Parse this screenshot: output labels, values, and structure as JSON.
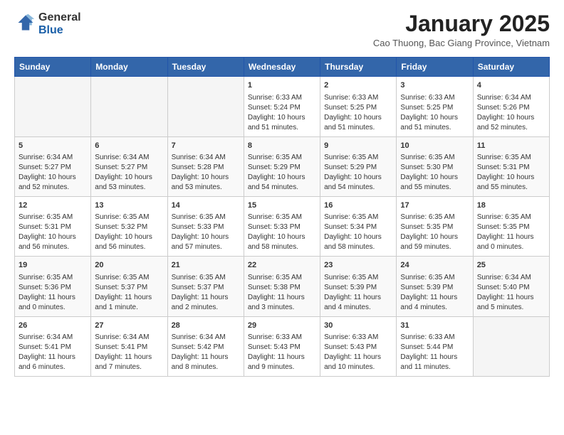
{
  "logo": {
    "general": "General",
    "blue": "Blue"
  },
  "header": {
    "month": "January 2025",
    "location": "Cao Thuong, Bac Giang Province, Vietnam"
  },
  "weekdays": [
    "Sunday",
    "Monday",
    "Tuesday",
    "Wednesday",
    "Thursday",
    "Friday",
    "Saturday"
  ],
  "weeks": [
    [
      {
        "day": "",
        "info": ""
      },
      {
        "day": "",
        "info": ""
      },
      {
        "day": "",
        "info": ""
      },
      {
        "day": "1",
        "info": "Sunrise: 6:33 AM\nSunset: 5:24 PM\nDaylight: 10 hours\nand 51 minutes."
      },
      {
        "day": "2",
        "info": "Sunrise: 6:33 AM\nSunset: 5:25 PM\nDaylight: 10 hours\nand 51 minutes."
      },
      {
        "day": "3",
        "info": "Sunrise: 6:33 AM\nSunset: 5:25 PM\nDaylight: 10 hours\nand 51 minutes."
      },
      {
        "day": "4",
        "info": "Sunrise: 6:34 AM\nSunset: 5:26 PM\nDaylight: 10 hours\nand 52 minutes."
      }
    ],
    [
      {
        "day": "5",
        "info": "Sunrise: 6:34 AM\nSunset: 5:27 PM\nDaylight: 10 hours\nand 52 minutes."
      },
      {
        "day": "6",
        "info": "Sunrise: 6:34 AM\nSunset: 5:27 PM\nDaylight: 10 hours\nand 53 minutes."
      },
      {
        "day": "7",
        "info": "Sunrise: 6:34 AM\nSunset: 5:28 PM\nDaylight: 10 hours\nand 53 minutes."
      },
      {
        "day": "8",
        "info": "Sunrise: 6:35 AM\nSunset: 5:29 PM\nDaylight: 10 hours\nand 54 minutes."
      },
      {
        "day": "9",
        "info": "Sunrise: 6:35 AM\nSunset: 5:29 PM\nDaylight: 10 hours\nand 54 minutes."
      },
      {
        "day": "10",
        "info": "Sunrise: 6:35 AM\nSunset: 5:30 PM\nDaylight: 10 hours\nand 55 minutes."
      },
      {
        "day": "11",
        "info": "Sunrise: 6:35 AM\nSunset: 5:31 PM\nDaylight: 10 hours\nand 55 minutes."
      }
    ],
    [
      {
        "day": "12",
        "info": "Sunrise: 6:35 AM\nSunset: 5:31 PM\nDaylight: 10 hours\nand 56 minutes."
      },
      {
        "day": "13",
        "info": "Sunrise: 6:35 AM\nSunset: 5:32 PM\nDaylight: 10 hours\nand 56 minutes."
      },
      {
        "day": "14",
        "info": "Sunrise: 6:35 AM\nSunset: 5:33 PM\nDaylight: 10 hours\nand 57 minutes."
      },
      {
        "day": "15",
        "info": "Sunrise: 6:35 AM\nSunset: 5:33 PM\nDaylight: 10 hours\nand 58 minutes."
      },
      {
        "day": "16",
        "info": "Sunrise: 6:35 AM\nSunset: 5:34 PM\nDaylight: 10 hours\nand 58 minutes."
      },
      {
        "day": "17",
        "info": "Sunrise: 6:35 AM\nSunset: 5:35 PM\nDaylight: 10 hours\nand 59 minutes."
      },
      {
        "day": "18",
        "info": "Sunrise: 6:35 AM\nSunset: 5:35 PM\nDaylight: 11 hours\nand 0 minutes."
      }
    ],
    [
      {
        "day": "19",
        "info": "Sunrise: 6:35 AM\nSunset: 5:36 PM\nDaylight: 11 hours\nand 0 minutes."
      },
      {
        "day": "20",
        "info": "Sunrise: 6:35 AM\nSunset: 5:37 PM\nDaylight: 11 hours\nand 1 minute."
      },
      {
        "day": "21",
        "info": "Sunrise: 6:35 AM\nSunset: 5:37 PM\nDaylight: 11 hours\nand 2 minutes."
      },
      {
        "day": "22",
        "info": "Sunrise: 6:35 AM\nSunset: 5:38 PM\nDaylight: 11 hours\nand 3 minutes."
      },
      {
        "day": "23",
        "info": "Sunrise: 6:35 AM\nSunset: 5:39 PM\nDaylight: 11 hours\nand 4 minutes."
      },
      {
        "day": "24",
        "info": "Sunrise: 6:35 AM\nSunset: 5:39 PM\nDaylight: 11 hours\nand 4 minutes."
      },
      {
        "day": "25",
        "info": "Sunrise: 6:34 AM\nSunset: 5:40 PM\nDaylight: 11 hours\nand 5 minutes."
      }
    ],
    [
      {
        "day": "26",
        "info": "Sunrise: 6:34 AM\nSunset: 5:41 PM\nDaylight: 11 hours\nand 6 minutes."
      },
      {
        "day": "27",
        "info": "Sunrise: 6:34 AM\nSunset: 5:41 PM\nDaylight: 11 hours\nand 7 minutes."
      },
      {
        "day": "28",
        "info": "Sunrise: 6:34 AM\nSunset: 5:42 PM\nDaylight: 11 hours\nand 8 minutes."
      },
      {
        "day": "29",
        "info": "Sunrise: 6:33 AM\nSunset: 5:43 PM\nDaylight: 11 hours\nand 9 minutes."
      },
      {
        "day": "30",
        "info": "Sunrise: 6:33 AM\nSunset: 5:43 PM\nDaylight: 11 hours\nand 10 minutes."
      },
      {
        "day": "31",
        "info": "Sunrise: 6:33 AM\nSunset: 5:44 PM\nDaylight: 11 hours\nand 11 minutes."
      },
      {
        "day": "",
        "info": ""
      }
    ]
  ]
}
